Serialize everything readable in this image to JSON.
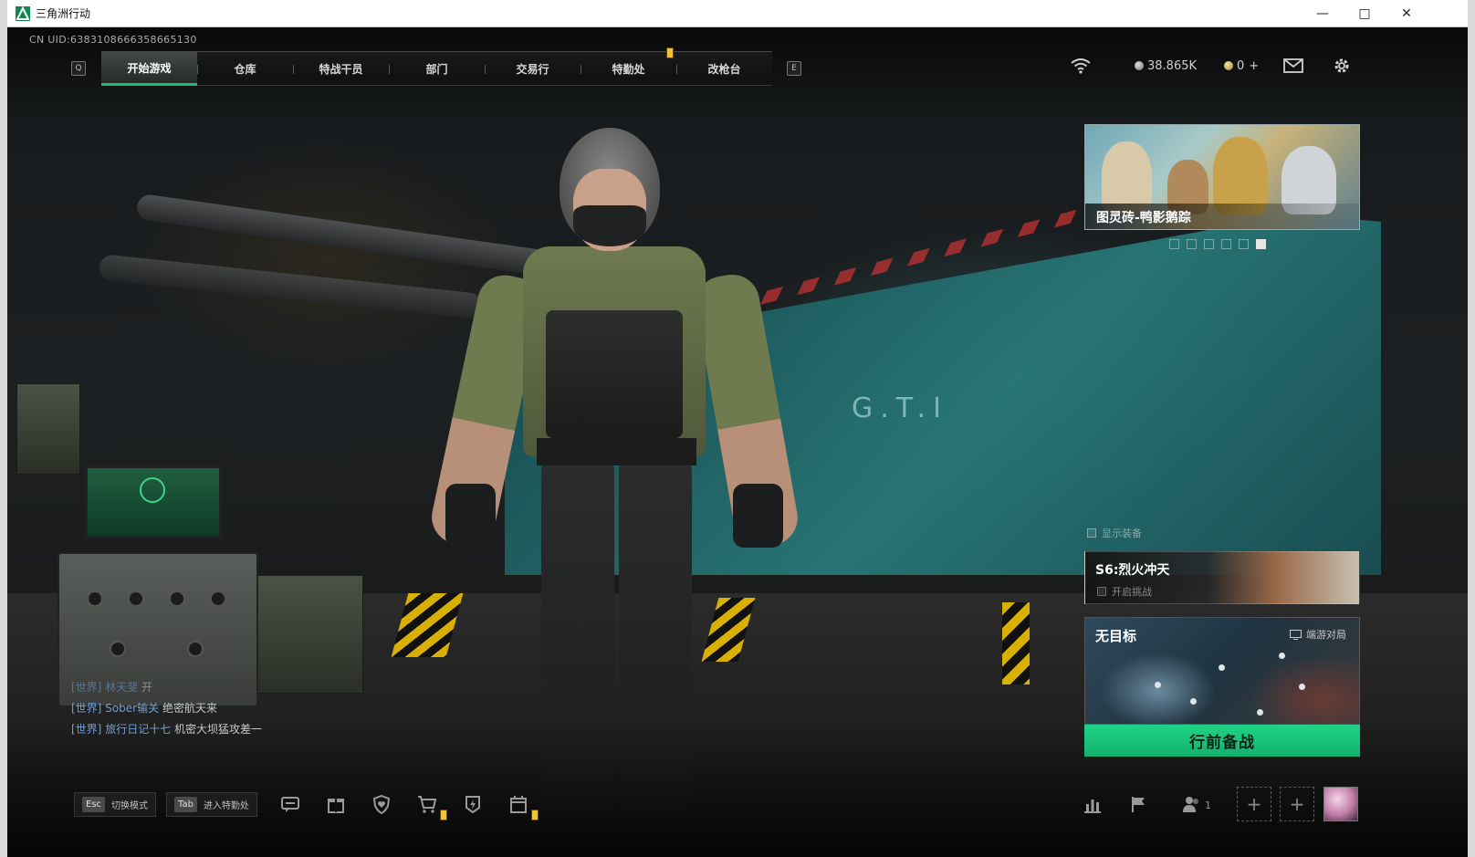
{
  "window": {
    "title": "三角洲行动",
    "accent": "#18c07a"
  },
  "hud": {
    "uid": "CN UID:638310866635866​5130",
    "nav": {
      "left_key": "Q",
      "right_key": "E",
      "tabs": [
        {
          "label": "开始游戏",
          "active": true
        },
        {
          "label": "仓库"
        },
        {
          "label": "特战干员"
        },
        {
          "label": "部门"
        },
        {
          "label": "交易行"
        },
        {
          "label": "特勤处"
        },
        {
          "label": "改枪台"
        }
      ]
    },
    "currency": {
      "silver": "38.865K",
      "gold": "0",
      "gold_add": "+"
    },
    "icons": [
      "wifi-icon",
      "mail-icon",
      "settings-gear-icon"
    ]
  },
  "banner": {
    "title": "图灵砖-鸭影鹅踪",
    "page_count": 6,
    "active_page": 6
  },
  "show_equipment": {
    "label": "显示装备"
  },
  "season": {
    "title": "S6:烈火冲天",
    "subtitle": "开启挑战"
  },
  "mode_card": {
    "title": "无目标",
    "mode": "端游对局"
  },
  "go_button": {
    "label": "行前备战"
  },
  "chat": [
    {
      "channel": "[世界]",
      "name": "林天斐",
      "text": "开"
    },
    {
      "channel": "[世界]",
      "name": "Sober输关",
      "text": "绝密航天来"
    },
    {
      "channel": "[世界]",
      "name": "旅行日记十七",
      "text": "机密大坝猛攻差一"
    }
  ],
  "bottom_bar": {
    "hints": [
      {
        "key": "Esc",
        "label": "切换模式"
      },
      {
        "key": "Tab",
        "label": "进入特勤处"
      }
    ],
    "icons": [
      "chat-icon",
      "gift-icon",
      "heart-shield-icon",
      "shop-cart-icon",
      "pass-icon",
      "calendar-icon",
      "stats-icon",
      "flag-icon",
      "team-icon"
    ],
    "team_count": "1",
    "slot_add": "+"
  }
}
